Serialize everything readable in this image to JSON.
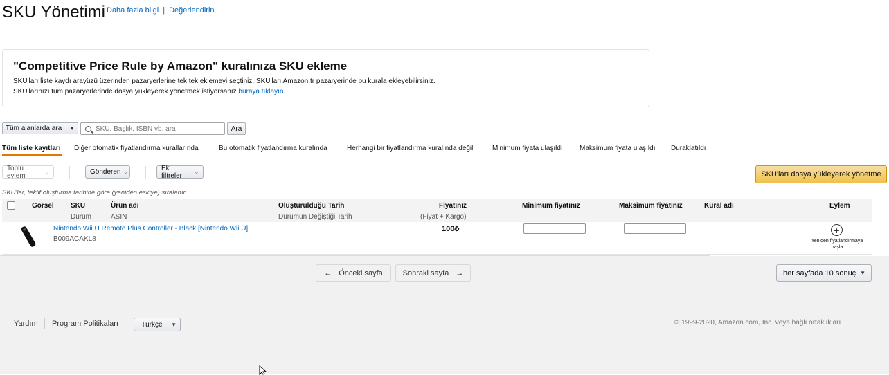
{
  "header": {
    "title": "SKU Yönetimi",
    "learn_more": "Daha fazla bilgi",
    "separator": "|",
    "rate": "Değerlendirin"
  },
  "info_card": {
    "title": "\"Competitive Price Rule by Amazon\" kuralınıza SKU ekleme",
    "line1": "SKU'ları liste kaydı arayüzü üzerinden pazaryerlerine tek tek eklemeyi seçtiniz. SKU'ları Amazon.tr pazaryerinde bu kurala ekleyebilirsiniz.",
    "line2_prefix": "SKU'larınızı tüm pazaryerlerinde dosya yükleyerek yönetmek istiyorsanız ",
    "line2_link": "buraya tıklayın."
  },
  "search": {
    "scope": "Tüm alanlarda ara",
    "placeholder": "SKU, Başlık, ISBN vb. ara",
    "button": "Ara"
  },
  "tabs": [
    {
      "label": "Tüm liste kayıtları",
      "active": true
    },
    {
      "label": "Diğer otomatik fiyatlandırma kurallarında",
      "active": false
    },
    {
      "label": "Bu otomatik fiyatlandırma kuralında",
      "active": false
    },
    {
      "label": "Herhangi bir fiyatlandırma kuralında değil",
      "active": false
    },
    {
      "label": "Minimum fiyata ulaşıldı",
      "active": false
    },
    {
      "label": "Maksimum fiyata ulaşıldı",
      "active": false
    },
    {
      "label": "Duraklatıldı",
      "active": false
    }
  ],
  "actions": {
    "bulk": "Toplu eylem",
    "sent": "Gönderen",
    "filters": "Ek filtreler",
    "upload": "SKU'ları dosya yükleyerek yönetme"
  },
  "sort_note": "SKU'lar, teklif oluşturma tarihine göre (yeniden eskiye) sıralanır.",
  "table": {
    "headers": {
      "image": "Görsel",
      "sku": "SKU",
      "status": "Durum",
      "product": "Ürün adı",
      "asin": "ASIN",
      "created": "Oluşturulduğu Tarih",
      "status_changed": "Durumun Değiştiği Tarih",
      "price": "Fiyatınız",
      "price_sub": "(Fiyat + Kargo)",
      "min_price": "Minimum fiyatınız",
      "max_price": "Maksimum fiyatınız",
      "rule": "Kural adı",
      "action": "Eylem"
    },
    "rows": [
      {
        "product": "Nintendo Wii U Remote Plus Controller - Black [Nintendo Wii U]",
        "asin": "B009ACAKL8",
        "price": "100₺",
        "min_price": "",
        "max_price": "",
        "action": "Yeniden fiyatlandırmaya başla"
      }
    ]
  },
  "pagination": {
    "prev": "Önceki sayfa",
    "next": "Sonraki sayfa",
    "per_page": "her sayfada 10 sonuç"
  },
  "footer": {
    "help": "Yardım",
    "policies": "Program Politikaları",
    "language": "Türkçe",
    "copyright": "© 1999-2020, Amazon.com, Inc. veya bağlı ortaklıkları"
  }
}
